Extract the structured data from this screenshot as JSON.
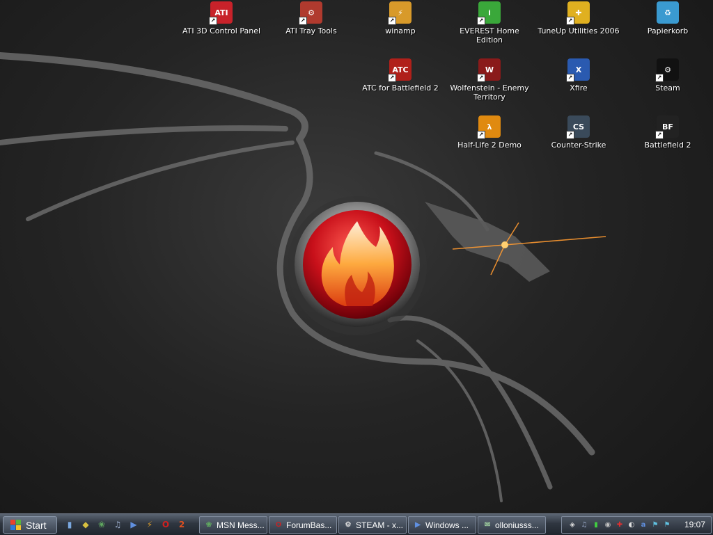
{
  "desktop_icons": [
    {
      "label": "ATI 3D Control Panel",
      "icon": "ati-icon",
      "glyph": "ATI",
      "color": "#c8222a",
      "shortcut": true
    },
    {
      "label": "ATI Tray Tools",
      "icon": "ati-tray-tools-icon",
      "glyph": "⚙",
      "color": "#b03a2e",
      "shortcut": true
    },
    {
      "label": "winamp",
      "icon": "winamp-icon",
      "glyph": "⚡",
      "color": "#d89a2a",
      "shortcut": true
    },
    {
      "label": "EVEREST Home Edition",
      "icon": "everest-icon",
      "glyph": "i",
      "color": "#3aa83a",
      "shortcut": true
    },
    {
      "label": "TuneUp Utilities 2006",
      "icon": "tuneup-icon",
      "glyph": "✚",
      "color": "#e0b020",
      "shortcut": true
    },
    {
      "label": "Papierkorb",
      "icon": "recycle-bin-icon",
      "glyph": "♻",
      "color": "#3a9ad0",
      "shortcut": false
    },
    {
      "label": "ATC for Battlefield 2",
      "icon": "atc-icon",
      "glyph": "ATC",
      "color": "#b0201a",
      "shortcut": true
    },
    {
      "label": "Wolfenstein - Enemy Territory",
      "icon": "wolfenstein-icon",
      "glyph": "W",
      "color": "#8a1a1a",
      "shortcut": true
    },
    {
      "label": "Xfire",
      "icon": "xfire-icon",
      "glyph": "X",
      "color": "#2a5ab0",
      "shortcut": true
    },
    {
      "label": "Steam",
      "icon": "steam-icon",
      "glyph": "⚙",
      "color": "#111111",
      "shortcut": true
    },
    {
      "label": "Half-Life 2 Demo",
      "icon": "half-life-icon",
      "glyph": "λ",
      "color": "#e08a10",
      "shortcut": true
    },
    {
      "label": "Counter-Strike",
      "icon": "counter-strike-icon",
      "glyph": "CS",
      "color": "#3a4a5a",
      "shortcut": true
    },
    {
      "label": "Battlefield 2",
      "icon": "battlefield-icon",
      "glyph": "BF",
      "color": "#222222",
      "shortcut": true
    }
  ],
  "taskbar": {
    "start_label": "Start",
    "quick_launch": [
      {
        "icon": "show-desktop-icon",
        "glyph": "▮",
        "color": "#7aa8e0"
      },
      {
        "icon": "quicklaunch-app-icon",
        "glyph": "◆",
        "color": "#d8c040"
      },
      {
        "icon": "msn-icon",
        "glyph": "❀",
        "color": "#60a860"
      },
      {
        "icon": "media-icon",
        "glyph": "♫",
        "color": "#a0b0d0"
      },
      {
        "icon": "windows-media-player-icon",
        "glyph": "▶",
        "color": "#6090e0"
      },
      {
        "icon": "winamp-icon",
        "glyph": "⚡",
        "color": "#d89a2a"
      },
      {
        "icon": "opera-icon",
        "glyph": "O",
        "color": "#d02020"
      },
      {
        "icon": "battlefield-icon",
        "glyph": "2",
        "color": "#e05020"
      }
    ],
    "tasks": [
      {
        "label": "MSN Mess...",
        "icon": "msn-icon",
        "glyph": "❀",
        "color": "#60a860"
      },
      {
        "label": "ForumBas...",
        "icon": "opera-icon",
        "glyph": "O",
        "color": "#d02020"
      },
      {
        "label": "STEAM - x...",
        "icon": "steam-icon",
        "glyph": "⚙",
        "color": "#dddddd"
      },
      {
        "label": "Windows ...",
        "icon": "windows-media-player-icon",
        "glyph": "▶",
        "color": "#6090e0"
      },
      {
        "label": "olloniusss...",
        "icon": "xfire-icon",
        "glyph": "✉",
        "color": "#a0d0a0"
      }
    ],
    "tray_icons": [
      {
        "icon": "tray-app-icon",
        "glyph": "◈",
        "color": "#dddddd"
      },
      {
        "icon": "headphones-icon",
        "glyph": "♫",
        "color": "#a0b0d0"
      },
      {
        "icon": "battery-icon",
        "glyph": "▮",
        "color": "#40d040"
      },
      {
        "icon": "speaker-icon",
        "glyph": "◉",
        "color": "#c0c0c0"
      },
      {
        "icon": "antivirus-icon",
        "glyph": "✚",
        "color": "#e03030"
      },
      {
        "icon": "mouse-icon",
        "glyph": "◐",
        "color": "#e0e0e0"
      },
      {
        "icon": "ati-tray-icon",
        "glyph": "a",
        "color": "#6090e0"
      },
      {
        "icon": "network-icon",
        "glyph": "⚑",
        "color": "#60c0e0"
      },
      {
        "icon": "network2-icon",
        "glyph": "⚑",
        "color": "#60c0e0"
      }
    ],
    "clock": "19:07"
  }
}
